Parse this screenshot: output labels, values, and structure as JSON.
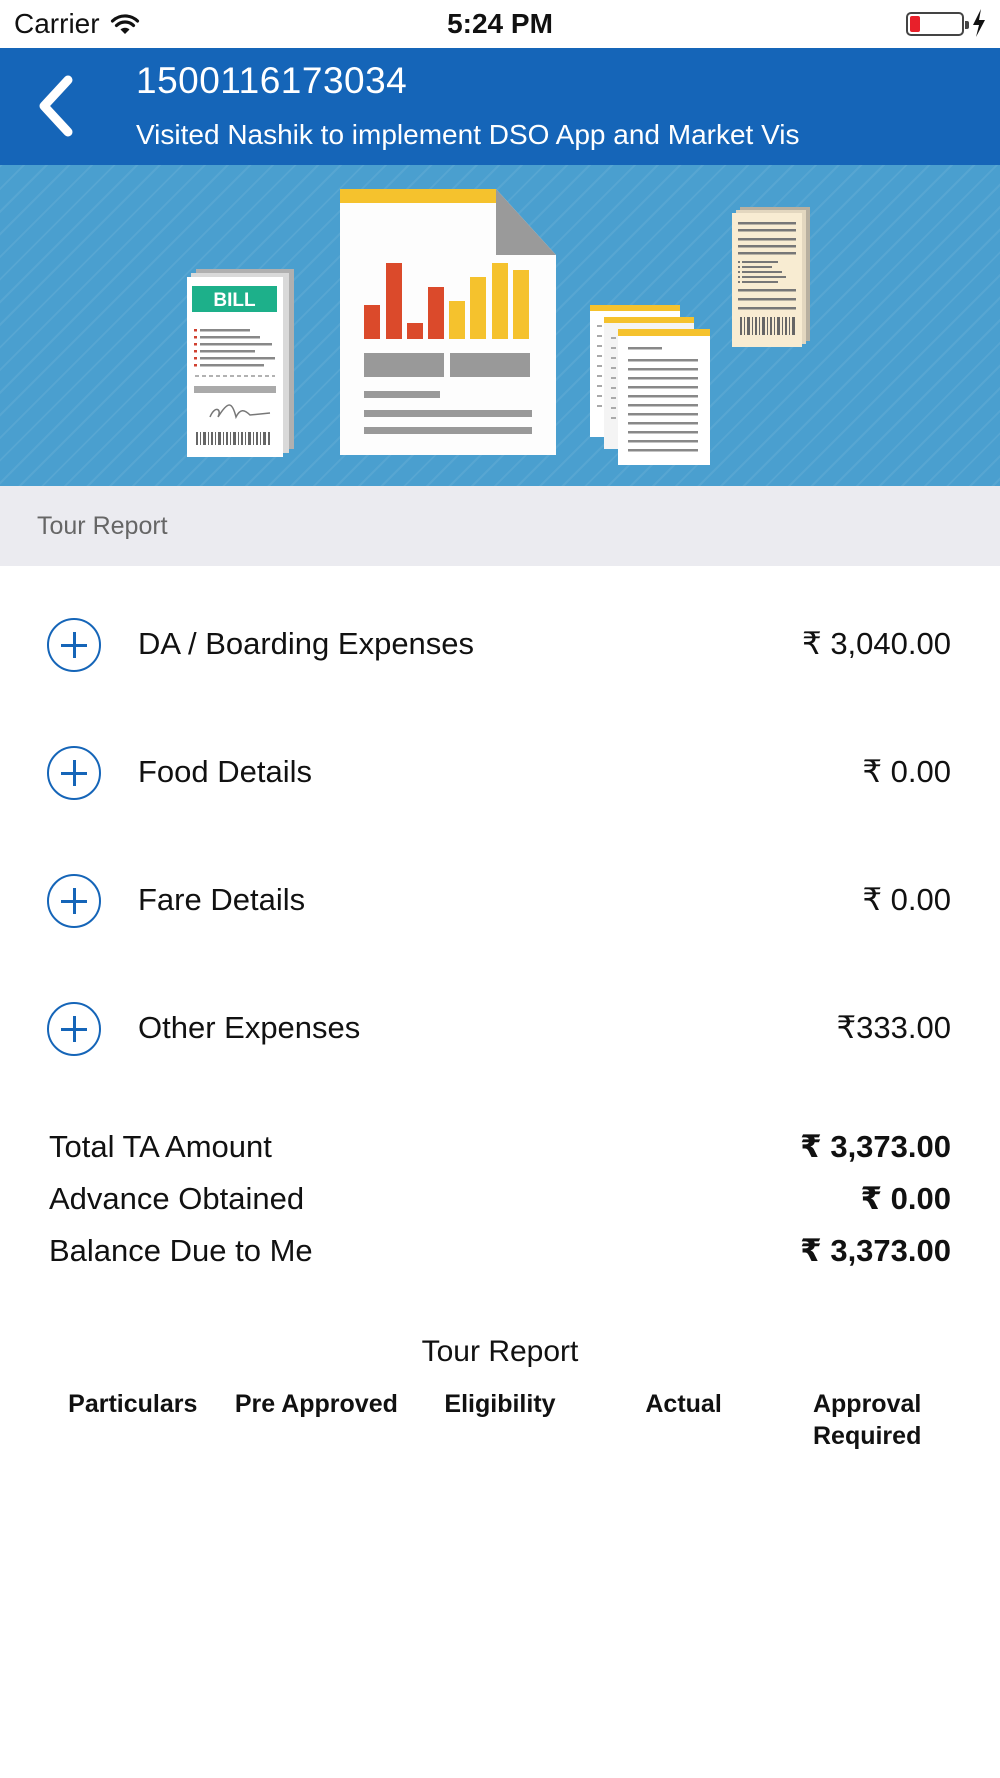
{
  "status_bar": {
    "carrier": "Carrier",
    "time": "5:24 PM",
    "battery_level": 0.2,
    "battery_color": "#e8202a",
    "icons": [
      "wifi-icon",
      "battery-icon",
      "charging-bolt-icon"
    ]
  },
  "header": {
    "title": "1500116173034",
    "subtitle": "Visited Nashik to implement DSO App and Market Vis",
    "back_icon": "chevron-left-icon",
    "background_color": "#1565b8"
  },
  "banner": {
    "bill_label": "BILL",
    "illustration": "bills-and-report-illustration"
  },
  "section": {
    "title": "Tour Report"
  },
  "expenses": [
    {
      "label": "DA / Boarding Expenses",
      "amount": "₹ 3,040.00"
    },
    {
      "label": "Food Details",
      "amount": "₹ 0.00"
    },
    {
      "label": "Fare Details",
      "amount": "₹ 0.00"
    },
    {
      "label": "Other Expenses",
      "amount": "₹333.00"
    }
  ],
  "totals": [
    {
      "label": "Total TA Amount",
      "amount": "₹ 3,373.00"
    },
    {
      "label": "Advance Obtained",
      "amount": "₹ 0.00"
    },
    {
      "label": "Balance Due to Me",
      "amount": "₹ 3,373.00"
    }
  ],
  "report_table": {
    "title": "Tour Report",
    "columns": [
      "Particulars",
      "Pre Approved",
      "Eligibility",
      "Actual",
      "Approval Required"
    ]
  },
  "colors": {
    "accent": "#1565b8",
    "banner": "#4a9fcf",
    "section_bg": "#ebebf0"
  }
}
